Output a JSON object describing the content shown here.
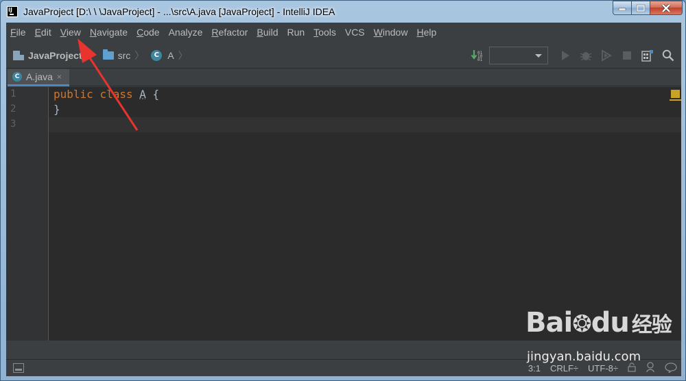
{
  "window": {
    "title": "JavaProject [D:\\          \\          \\JavaProject] - ...\\src\\A.java [JavaProject] - IntelliJ IDEA"
  },
  "menu": [
    {
      "label": "File",
      "mnemonic": "F",
      "rest": "ile"
    },
    {
      "label": "Edit",
      "mnemonic": "E",
      "rest": "dit"
    },
    {
      "label": "View",
      "mnemonic": "V",
      "rest": "iew"
    },
    {
      "label": "Navigate",
      "mnemonic": "N",
      "rest": "avigate"
    },
    {
      "label": "Code",
      "mnemonic": "C",
      "rest": "ode"
    },
    {
      "label": "Analyze",
      "mnemonic": "",
      "rest": "Analyze"
    },
    {
      "label": "Refactor",
      "mnemonic": "R",
      "rest": "efactor"
    },
    {
      "label": "Build",
      "mnemonic": "B",
      "rest": "uild"
    },
    {
      "label": "Run",
      "mnemonic": "",
      "rest": "Run"
    },
    {
      "label": "Tools",
      "mnemonic": "T",
      "rest": "ools"
    },
    {
      "label": "VCS",
      "mnemonic": "",
      "rest": "VCS"
    },
    {
      "label": "Window",
      "mnemonic": "W",
      "rest": "indow"
    },
    {
      "label": "Help",
      "mnemonic": "H",
      "rest": "elp"
    }
  ],
  "breadcrumb": {
    "project": "JavaProject",
    "folder": "src",
    "class_icon": "C",
    "class": "A"
  },
  "tab": {
    "icon": "C",
    "label": "A.java",
    "close": "×"
  },
  "editor": {
    "line_numbers": [
      "1",
      "2",
      "3"
    ],
    "line1": {
      "kw1": "public",
      "kw2": "class",
      "name": "A",
      "brace": "{"
    },
    "line2": "}"
  },
  "status": {
    "position": "3:1",
    "line_sep": "CRLF÷",
    "encoding": "UTF-8÷"
  },
  "watermark": {
    "brand": "Bai",
    "brand2": "du",
    "brand3": "经验",
    "url": "jingyan.baidu.com"
  },
  "colors": {
    "keyword": "#cc7832",
    "text": "#a9b7c6",
    "editor_bg": "#2b2b2b",
    "chrome_bg": "#3c3f41",
    "annotation_arrow": "#e8342e"
  }
}
